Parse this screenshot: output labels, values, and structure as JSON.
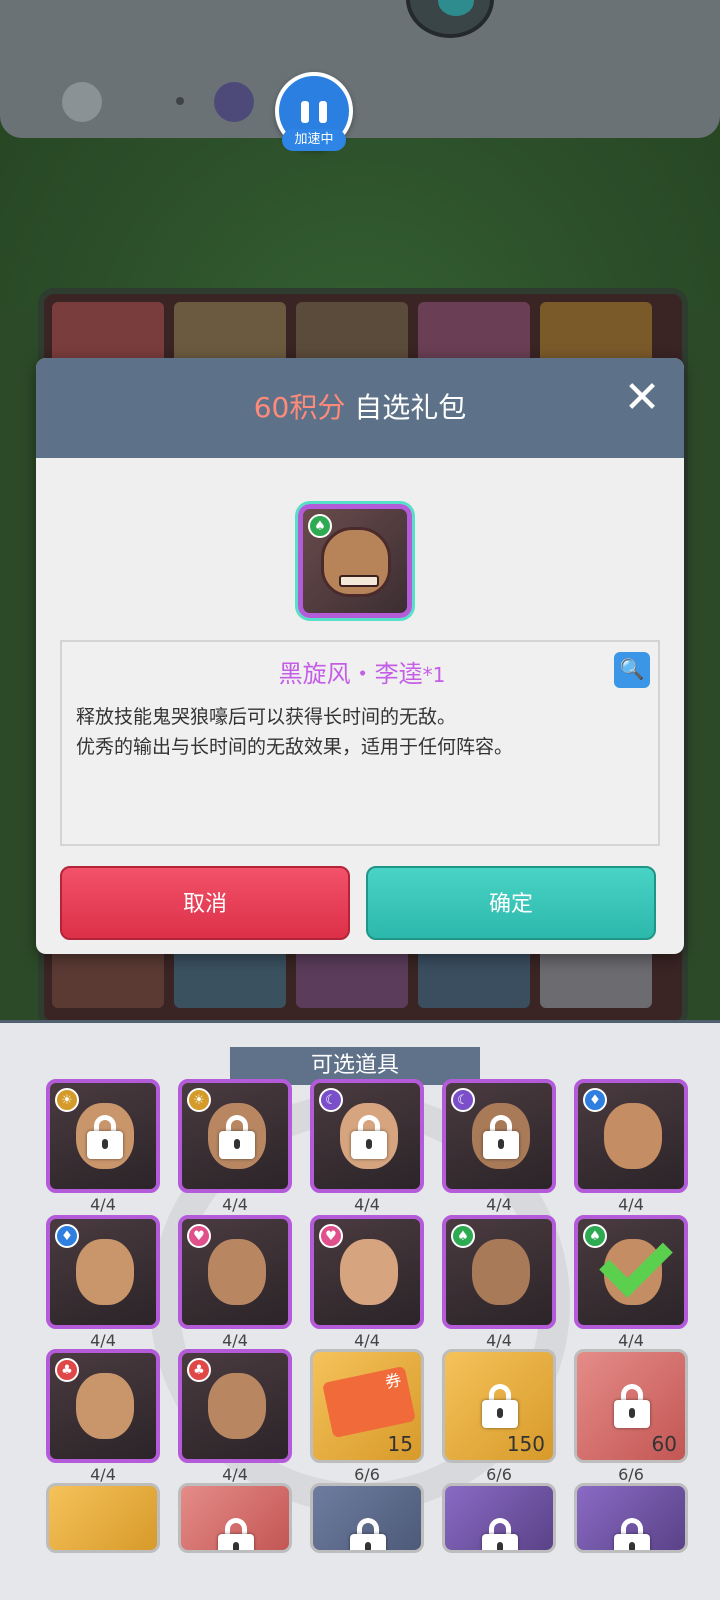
{
  "speed_badge": {
    "label": "加速中"
  },
  "dialog": {
    "points": "60积分",
    "title": "自选礼包",
    "close_icon": "close-icon",
    "selected_item": {
      "name": "黑旋风・李逵",
      "count": "*1",
      "suit": "spade",
      "suit_color": "#2eaa52",
      "description_lines": [
        "释放技能鬼哭狼嚎后可以获得长时间的无敌。",
        "优秀的输出与长时间的无敌效果，适用于任何阵容。"
      ]
    },
    "cancel_label": "取消",
    "confirm_label": "确定"
  },
  "panel": {
    "title": "可选道具",
    "rows": [
      [
        {
          "type": "hero",
          "suit": "sun",
          "suit_color": "#d49a2a",
          "locked": true,
          "caption": "4/4"
        },
        {
          "type": "hero",
          "suit": "sun",
          "suit_color": "#d49a2a",
          "locked": true,
          "caption": "4/4"
        },
        {
          "type": "hero",
          "suit": "moon",
          "suit_color": "#7a4fc9",
          "locked": true,
          "caption": "4/4"
        },
        {
          "type": "hero",
          "suit": "moon",
          "suit_color": "#7a4fc9",
          "locked": true,
          "caption": "4/4"
        },
        {
          "type": "hero",
          "suit": "diamond",
          "suit_color": "#2f7fe0",
          "locked": false,
          "caption": "4/4"
        }
      ],
      [
        {
          "type": "hero",
          "suit": "diamond",
          "suit_color": "#2f7fe0",
          "locked": false,
          "caption": "4/4"
        },
        {
          "type": "hero",
          "suit": "heart",
          "suit_color": "#e0508a",
          "locked": false,
          "caption": "4/4"
        },
        {
          "type": "hero",
          "suit": "heart",
          "suit_color": "#e0508a",
          "locked": false,
          "caption": "4/4"
        },
        {
          "type": "hero",
          "suit": "spade",
          "suit_color": "#2eaa52",
          "locked": false,
          "caption": "4/4"
        },
        {
          "type": "hero",
          "suit": "spade",
          "suit_color": "#2eaa52",
          "locked": false,
          "selected": true,
          "caption": "4/4"
        }
      ],
      [
        {
          "type": "hero",
          "suit": "club",
          "suit_color": "#e04848",
          "locked": false,
          "caption": "4/4"
        },
        {
          "type": "hero",
          "suit": "club",
          "suit_color": "#e04848",
          "locked": false,
          "caption": "4/4"
        },
        {
          "type": "item",
          "style": "ticket",
          "ticket_text": "券",
          "locked": false,
          "qty": "15",
          "caption": "6/6"
        },
        {
          "type": "item",
          "style": "gold",
          "locked": true,
          "qty": "150",
          "caption": "6/6"
        },
        {
          "type": "item",
          "style": "red",
          "locked": true,
          "qty": "60",
          "caption": "6/6"
        }
      ],
      [
        {
          "type": "item",
          "style": "gold",
          "locked": false,
          "qty": "",
          "caption": ""
        },
        {
          "type": "item",
          "style": "red",
          "locked": true,
          "qty": "",
          "caption": ""
        },
        {
          "type": "item",
          "style": "gray",
          "locked": true,
          "qty": "",
          "caption": ""
        },
        {
          "type": "item",
          "style": "purple",
          "locked": true,
          "qty": "",
          "caption": ""
        },
        {
          "type": "item",
          "style": "purple",
          "locked": true,
          "qty": "",
          "caption": ""
        }
      ]
    ]
  }
}
